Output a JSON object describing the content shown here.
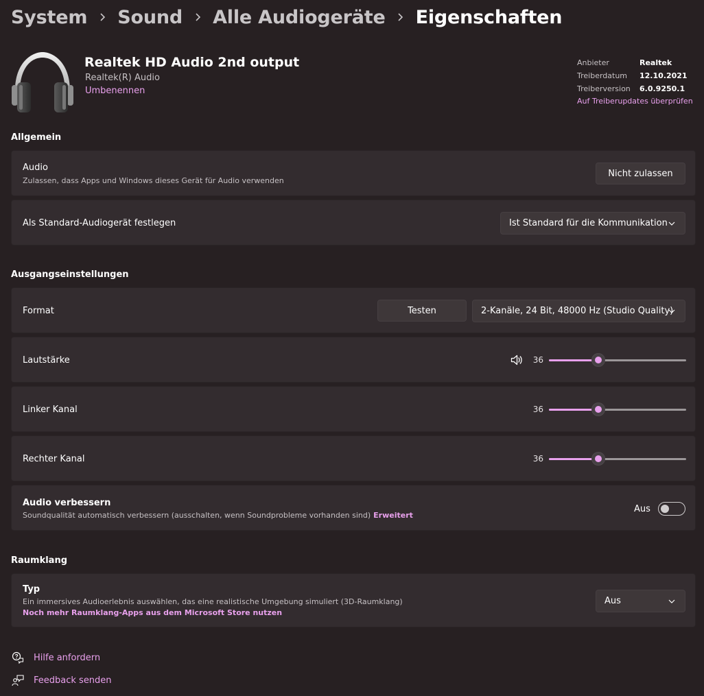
{
  "breadcrumb": {
    "items": [
      "System",
      "Sound",
      "Alle Audiogeräte",
      "Eigenschaften"
    ]
  },
  "device": {
    "icon": "headphones-icon",
    "name": "Realtek HD Audio 2nd output",
    "subtitle": "Realtek(R) Audio",
    "rename_link": "Umbenennen"
  },
  "driver_info": {
    "rows": [
      {
        "key": "Anbieter",
        "value": "Realtek"
      },
      {
        "key": "Treiberdatum",
        "value": "12.10.2021"
      },
      {
        "key": "Treiberversion",
        "value": "6.0.9250.1"
      }
    ],
    "update_link": "Auf Treiberupdates überprüfen"
  },
  "general": {
    "title": "Allgemein",
    "audio": {
      "label": "Audio",
      "description": "Zulassen, dass Apps und Windows dieses Gerät für Audio verwenden",
      "button": "Nicht zulassen"
    },
    "default_device": {
      "label": "Als Standard-Audiogerät festlegen",
      "selected": "Ist Standard für die Kommunikation"
    }
  },
  "output": {
    "title": "Ausgangseinstellungen",
    "format": {
      "label": "Format",
      "test_button": "Testen",
      "selected": "2-Kanäle, 24 Bit, 48000 Hz (Studio Quality)"
    },
    "volume": {
      "label": "Lautstärke",
      "value": 36,
      "icon": "speaker-icon"
    },
    "left_channel": {
      "label": "Linker Kanal",
      "value": 36
    },
    "right_channel": {
      "label": "Rechter Kanal",
      "value": 36
    },
    "enhance": {
      "label": "Audio verbessern",
      "description": "Soundqualität automatisch verbessern (ausschalten, wenn Soundprobleme vorhanden sind)",
      "link": "Erweitert",
      "state_label": "Aus",
      "on": false
    }
  },
  "spatial": {
    "title": "Raumklang",
    "type": {
      "label": "Typ",
      "description": "Ein immersives Audioerlebnis auswählen, das eine realistische Umgebung simuliert (3D-Raumklang)",
      "store_link": "Noch mehr Raumklang-Apps aus dem Microsoft Store nutzen",
      "selected": "Aus"
    }
  },
  "footer": {
    "help": {
      "label": "Hilfe anfordern",
      "icon": "help-icon"
    },
    "feedback": {
      "label": "Feedback senden",
      "icon": "feedback-icon"
    }
  },
  "colors": {
    "background": "#272022",
    "card": "#332c2f",
    "accent": "#e8a0ec",
    "text_secondary": "#c6c1c4"
  }
}
